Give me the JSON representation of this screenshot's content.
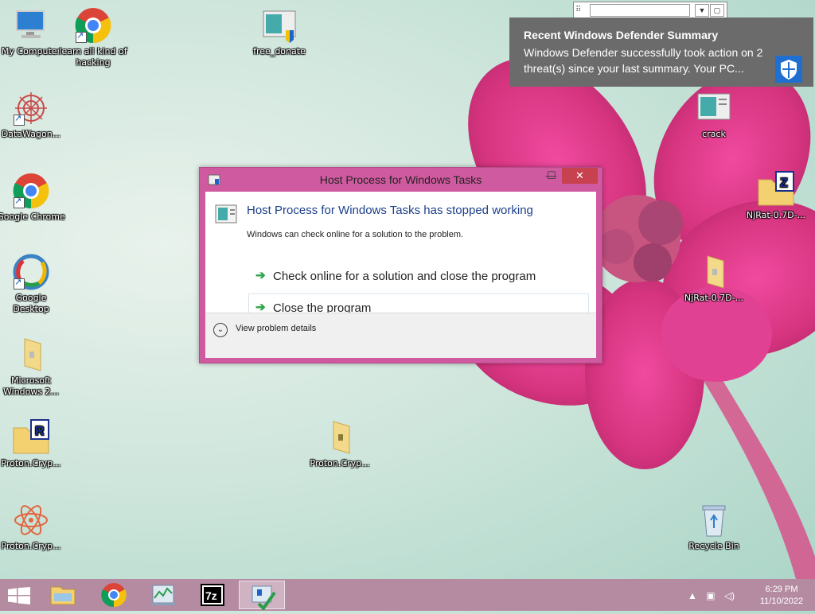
{
  "desktop": {
    "icons": [
      {
        "label": "My Computer"
      },
      {
        "label": "learn all kind of hacking"
      },
      {
        "label": "free_donate"
      },
      {
        "label": "DataWagon..."
      },
      {
        "label": "Google Chrome"
      },
      {
        "label": "Google Desktop"
      },
      {
        "label": "Microsoft Windows 2..."
      },
      {
        "label": "Proton.Cryp..."
      },
      {
        "label": "Proton.Cryp..."
      },
      {
        "label": "Proton.Cryp..."
      },
      {
        "label": "crack"
      },
      {
        "label": "NjRat-0.7D-..."
      },
      {
        "label": "NjRat-0.7D-..."
      },
      {
        "label": "Recycle Bin"
      }
    ]
  },
  "toast": {
    "title": "Recent Windows Defender Summary",
    "body": "Windows Defender successfully took action on 2 threat(s) since your last summary. Your PC..."
  },
  "dialog": {
    "title": "Host Process for Windows Tasks",
    "heading": "Host Process for Windows Tasks has stopped working",
    "subtext": "Windows can check online for a solution to the problem.",
    "options": [
      {
        "label": "Check online for a solution and close the program"
      },
      {
        "label": "Close the program"
      }
    ],
    "details_label": "View problem details",
    "close_glyph": "✕",
    "min_glyph": "—",
    "max_glyph": "☐"
  },
  "taskbar": {
    "time": "6:29 PM",
    "date": "11/10/2022"
  },
  "colors": {
    "dialog_frame": "#d05aa0",
    "heading": "#1c3f8a",
    "taskbar": "#b58ba2",
    "toast_bg": "#6b6b6b"
  }
}
